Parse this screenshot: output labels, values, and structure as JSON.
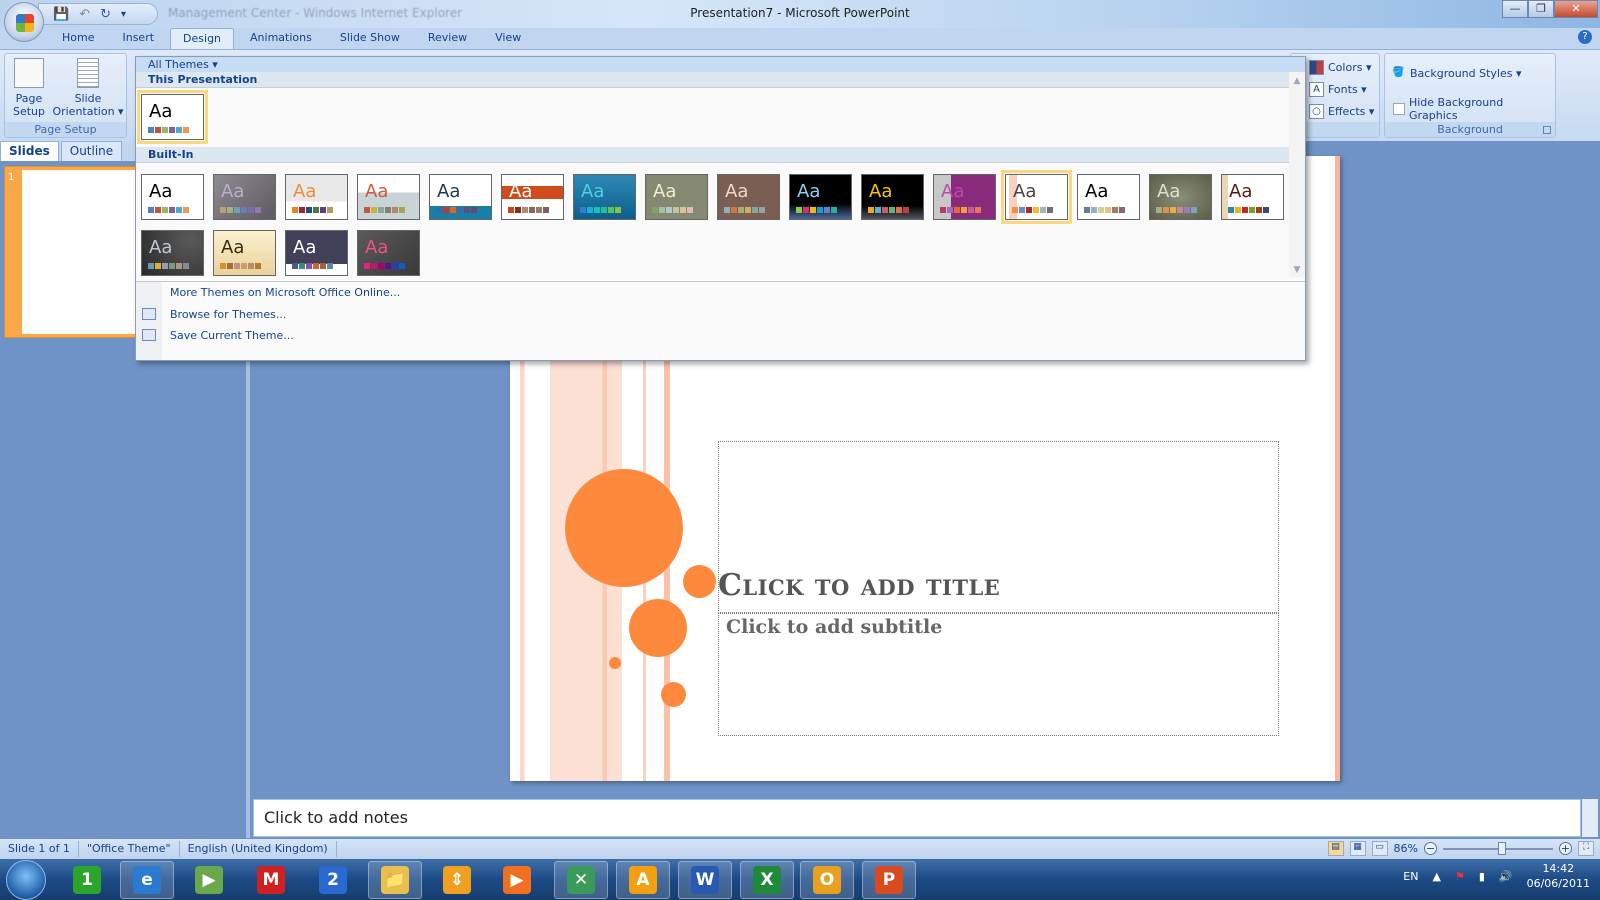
{
  "window": {
    "title": "Presentation7 - Microsoft PowerPoint",
    "background_title": "Management Center - Windows Internet Explorer"
  },
  "qat": {
    "save": "save-icon",
    "undo": "undo-icon",
    "redo": "redo-icon",
    "customize": "▾"
  },
  "tabs": [
    "Home",
    "Insert",
    "Design",
    "Animations",
    "Slide Show",
    "Review",
    "View"
  ],
  "active_tab": "Design",
  "ribbon": {
    "page_setup": {
      "page_setup": "Page Setup",
      "slide_orientation": "Slide Orientation ▾",
      "group": "Page Setup"
    },
    "themes": {
      "colors": "Colors ▾",
      "fonts": "Fonts ▾",
      "effects": "Effects ▾"
    },
    "background": {
      "styles": "Background Styles ▾",
      "hide_graphics": "Hide Background Graphics",
      "hide_graphics_checked": false,
      "group": "Background"
    }
  },
  "gallery": {
    "filter": "All Themes ▾",
    "this_presentation": "This Presentation",
    "built_in": "Built-In",
    "current": {
      "bg": "#ffffff",
      "fg": "#000000",
      "sw": [
        "#4f81bd",
        "#c0504d",
        "#9bbb59",
        "#8064a2",
        "#4bacc6",
        "#f79646"
      ]
    },
    "themes": [
      {
        "bg": "#ffffff",
        "fg": "#000000",
        "sw": [
          "#4f81bd",
          "#c0504d",
          "#9bbb59",
          "#8064a2",
          "#4bacc6",
          "#f79646"
        ]
      },
      {
        "bg": "linear-gradient(135deg,#8f8b93,#5d5a60)",
        "fg": "#b8b0c8",
        "sw": [
          "#b3a36e",
          "#9fb17c",
          "#6fa0b6",
          "#6c79ba",
          "#7d69b0",
          "#9a73b6"
        ]
      },
      {
        "bg": "linear-gradient(#e8e8e8 0 60%,#fff 60%)",
        "fg": "#f08a3c",
        "sw": [
          "#e8821e",
          "#9b2335",
          "#1e4e79",
          "#4b7a3f",
          "#5a4178",
          "#b69862"
        ]
      },
      {
        "bg": "linear-gradient(#fff 0 40%,#c8d4d8 40%)",
        "fg": "#d2563a",
        "sw": [
          "#c8543a",
          "#c8b434",
          "#8aa896",
          "#8a7c70",
          "#b08a6a",
          "#a8a060"
        ]
      },
      {
        "bg": "linear-gradient(#fff 0 70%,#1a7fa6 70%)",
        "fg": "#1f3550",
        "sw": [
          "#2b6fa8",
          "#c0392b",
          "#d86a20",
          "#3c6aa8",
          "#5b4e8a",
          "#6a4a6a"
        ]
      },
      {
        "bg": "linear-gradient(#fff 0 25%,#d24b1c 25% 55%,#fff 55%)",
        "fg": "#ffffff",
        "sw": [
          "#c8481e",
          "#8a2a1e",
          "#a89070",
          "#8a6a5a",
          "#9a7a70",
          "#806060"
        ]
      },
      {
        "bg": "linear-gradient(#2e89b8,#0c5f8c)",
        "fg": "#4fd0e0",
        "sw": [
          "#2a7fd0",
          "#1ab0d8",
          "#18c0c0",
          "#20c090",
          "#60c060",
          "#90c040"
        ]
      },
      {
        "bg": "#858872",
        "fg": "#eeeed0",
        "sw": [
          "#7ea46a",
          "#a8c0a0",
          "#b0c8d0",
          "#c8c0a0",
          "#d8c890",
          "#e0b8b8"
        ]
      },
      {
        "bg": "#7a5e52",
        "fg": "#eed8c8",
        "sw": [
          "#90b0c8",
          "#d07a40",
          "#a8b070",
          "#c8b060",
          "#80a8a0",
          "#9aa0a8"
        ]
      },
      {
        "bg": "linear-gradient(#000 0 65%,#4a6a9a)",
        "fg": "#8ad0f8",
        "sw": [
          "#8cc84a",
          "#e02a6a",
          "#f0b820",
          "#10a0d0",
          "#6a7ac8",
          "#20b0a0"
        ]
      },
      {
        "bg": "linear-gradient(#000 0 70%,#505660)",
        "fg": "#f8c800",
        "sw": [
          "#f0a820",
          "#5ab0d0",
          "#d05a6a",
          "#6ab070",
          "#e07040",
          "#c04040"
        ]
      },
      {
        "bg": "linear-gradient(90deg,#c8c8c8 0 28%,#8a2a7a 28%)",
        "fg": "#c048a8",
        "sw": [
          "#b83a6a",
          "#a86ab8",
          "#e06a40",
          "#f0a040",
          "#c85a9a",
          "#e87850"
        ]
      },
      {
        "bg": "linear-gradient(90deg,#fff 0 5%,#f8d0c0 5% 18%,#fff 18%)",
        "fg": "#444444",
        "sw": [
          "#fd8a3c",
          "#6a8ac8",
          "#b02828",
          "#e8c030",
          "#a8b0c8",
          "#707070"
        ]
      },
      {
        "bg": "#ffffff",
        "fg": "#000000",
        "sw": [
          "#6a7a9a",
          "#9ab0c8",
          "#d8d090",
          "#e8c080",
          "#a87a6a",
          "#8a6a6a"
        ]
      },
      {
        "bg": "radial-gradient(#8a8e78,#5a5e48)",
        "fg": "#dde0d0",
        "sw": [
          "#a8b080",
          "#e09050",
          "#e8b040",
          "#c08a9a",
          "#9a80b0",
          "#80a0c0"
        ]
      },
      {
        "bg": "linear-gradient(90deg,#e8d8b8 0 10%,#fff 10%)",
        "fg": "#5a1a10",
        "sw": [
          "#2a8aa0",
          "#f0b020",
          "#c02828",
          "#7a9a30",
          "#a04010",
          "#3a4a70"
        ]
      },
      {
        "bg": "radial-gradient(circle at 80% 20%,#5a5a5a,#2a2a2a)",
        "fg": "#c0c8d0",
        "sw": [
          "#6a9ab0",
          "#d8b030",
          "#9a9ab8",
          "#7a9a7a",
          "#a89a80",
          "#8a8a9a"
        ]
      },
      {
        "bg": "linear-gradient(#fbf0d0,#ead29a)",
        "fg": "#3a2a10",
        "sw": [
          "#d8902a",
          "#a86a40",
          "#c09080",
          "#c8a070",
          "#b89060",
          "#b87830"
        ]
      },
      {
        "bg": "linear-gradient(#404058 0 75%,#fff 75%)",
        "fg": "#ffffff",
        "sw": [
          "#4a5a8a",
          "#3a8a8a",
          "#9a4aa0",
          "#c06a30",
          "#a0603a",
          "#5a8aa8"
        ]
      },
      {
        "bg": "linear-gradient(135deg,#5a5a5a,#3a3a3a)",
        "fg": "#f0508a",
        "sw": [
          "#e82080",
          "#c01870",
          "#9a0a6a",
          "#60108a",
          "#2040c0",
          "#0a60c8"
        ]
      }
    ],
    "menu": [
      "More Themes on Microsoft Office Online...",
      "Browse for Themes...",
      "Save Current Theme..."
    ]
  },
  "slides_pane": {
    "tabs": [
      "Slides",
      "Outline"
    ],
    "slide_number": "1"
  },
  "slide": {
    "title": "Click to add title",
    "subtitle": "Click to add subtitle",
    "accent": "#fd8a3c"
  },
  "notes": {
    "placeholder": "Click to add notes"
  },
  "status": {
    "slide": "Slide 1 of 1",
    "theme": "\"Office Theme\"",
    "language": "English (United Kingdom)",
    "zoom": "86%",
    "zoom_percent": 86
  },
  "taskbar": {
    "apps": [
      {
        "name": "badge-1-icon",
        "label": "1",
        "color": "#2aa52a"
      },
      {
        "name": "internet-explorer-icon",
        "label": "e",
        "color": "#2a7ad0",
        "active": true
      },
      {
        "name": "media-center-icon",
        "label": "▶",
        "color": "#6aa84a"
      },
      {
        "name": "m-app-icon",
        "label": "M",
        "color": "#d02020"
      },
      {
        "name": "badge-2-icon",
        "label": "2",
        "color": "#2a6ad0"
      },
      {
        "name": "windows-explorer-icon",
        "label": "📁",
        "color": "#e8c050",
        "active": true
      },
      {
        "name": "arrows-app-icon",
        "label": "⇕",
        "color": "#f0a020"
      },
      {
        "name": "media-player-icon",
        "label": "▶",
        "color": "#f07020"
      },
      {
        "name": "messenger-icon",
        "label": "✕",
        "color": "#3a9a5a",
        "active": true
      },
      {
        "name": "acrobat-icon",
        "label": "A",
        "color": "#f0a010",
        "active": true
      },
      {
        "name": "word-icon",
        "label": "W",
        "color": "#2a5ab0",
        "active": true
      },
      {
        "name": "excel-icon",
        "label": "X",
        "color": "#1f8a3a",
        "active": true
      },
      {
        "name": "outlook-icon",
        "label": "O",
        "color": "#e8a020",
        "active": true
      },
      {
        "name": "powerpoint-icon",
        "label": "P",
        "color": "#d84a20",
        "active": true
      }
    ],
    "language": "EN",
    "time": "14:42",
    "date": "06/06/2011"
  }
}
